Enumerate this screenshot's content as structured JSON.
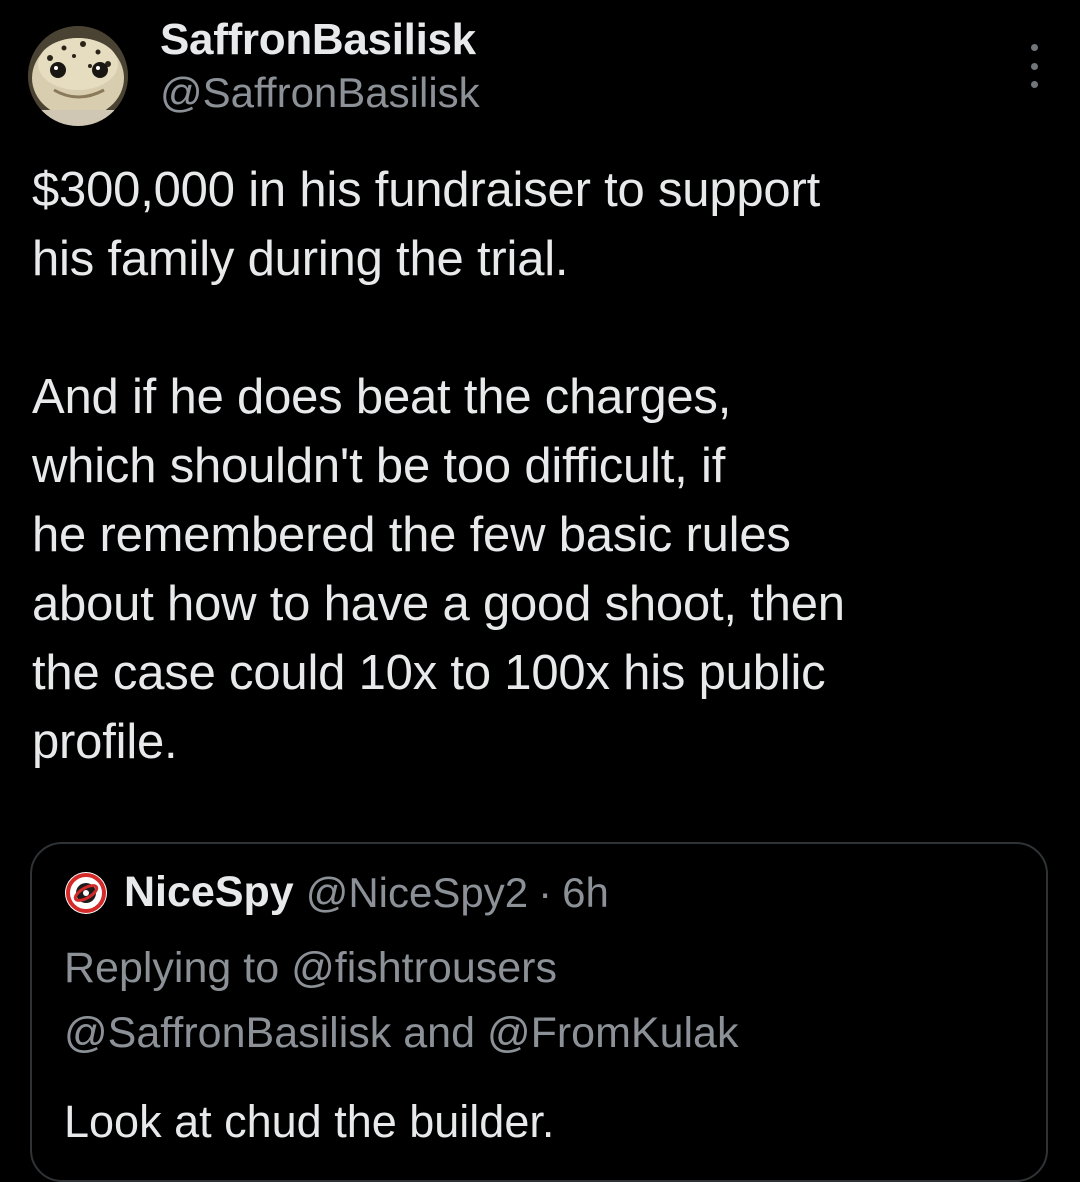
{
  "author": {
    "display_name": "SaffronBasilisk",
    "handle": "@SaffronBasilisk",
    "avatar_icon": "gecko-avatar-icon"
  },
  "more_icon": "more-vertical-icon",
  "tweet": {
    "paragraphs": [
      "$300,000 in his fundraiser to support\nhis family during the trial.",
      "And if he does beat the charges,\nwhich shouldn't be too difficult, if\nhe remembered the few basic rules\nabout how to have a good shoot, then\nthe case could 10x to 100x his public\nprofile."
    ]
  },
  "quote": {
    "avatar_icon": "red-target-avatar-icon",
    "display_name": "NiceSpy",
    "handle": "@NiceSpy2",
    "separator": "·",
    "time": "6h",
    "replying_prefix": "Replying to",
    "mentions": [
      "@fishtrousers",
      "@SaffronBasilisk",
      "@FromKulak"
    ],
    "mention_conjunction": "and",
    "text": "Look at chud the builder."
  },
  "colors": {
    "background": "#000000",
    "primary_text": "#e7e9ea",
    "secondary_text": "#8b9197",
    "border": "#2f3336"
  }
}
